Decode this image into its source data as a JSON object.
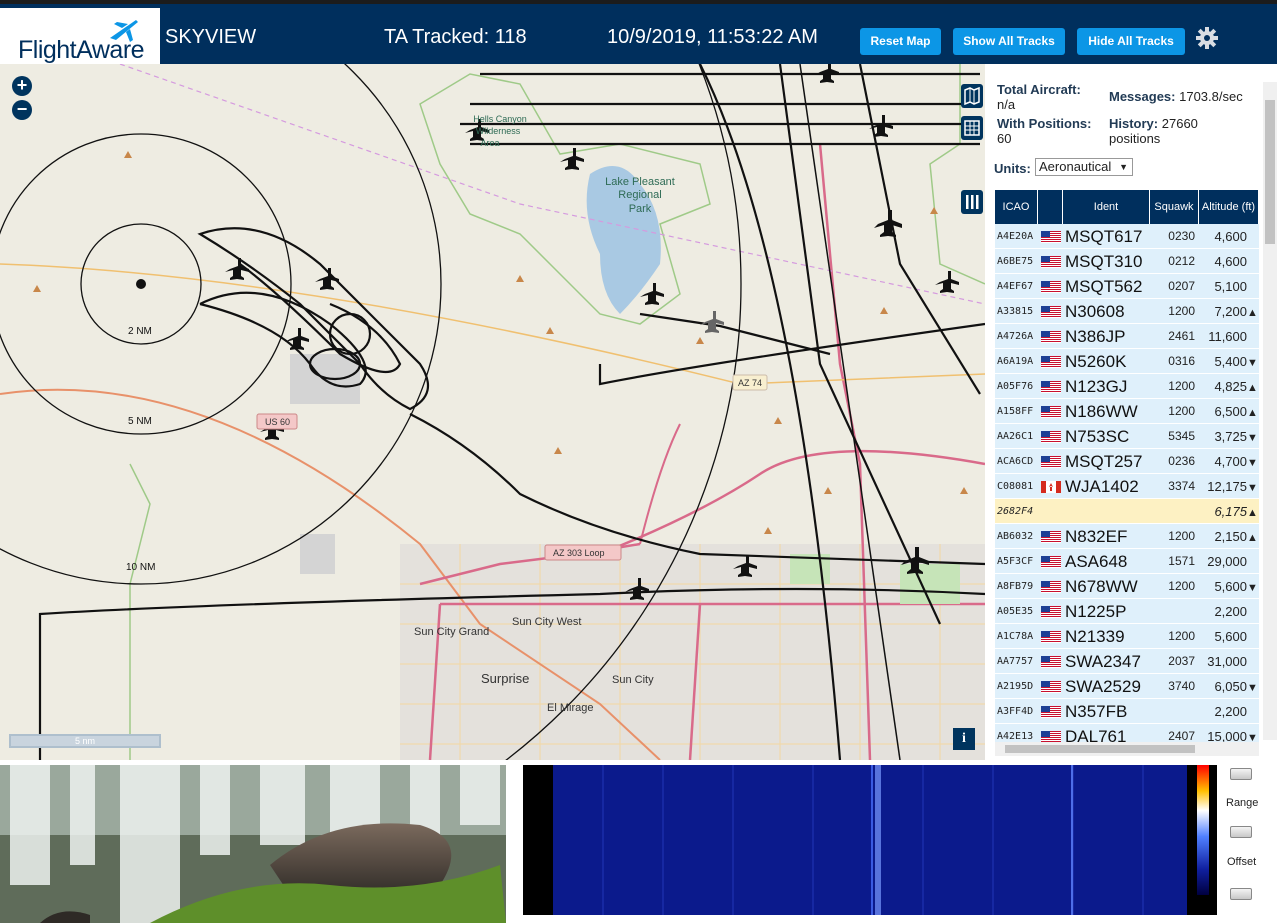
{
  "app": {
    "brand": "FlightAware",
    "title": "SKYVIEW",
    "ta_tracked_label": "TA Tracked: 118",
    "datetime": "10/9/2019, 11:53:22 AM",
    "buttons": {
      "reset_map": "Reset Map",
      "show_all_tracks": "Show All Tracks",
      "hide_all_tracks": "Hide All Tracks"
    }
  },
  "map": {
    "place_labels": [
      "Lake Pleasant Regional Park",
      "Sun City Grand",
      "Sun City West",
      "Surprise",
      "Sun City",
      "El Mirage",
      "Hells Canyon Wilderness Area"
    ],
    "road_labels": [
      "US 60",
      "AZ 74",
      "AZ 303 Loop"
    ],
    "range_rings": [
      "2 NM",
      "5 NM",
      "10 NM"
    ],
    "scale_label": "5 nm"
  },
  "sidebar": {
    "total_aircraft_label": "Total Aircraft:",
    "total_aircraft_value": "n/a",
    "with_positions_label": "With Positions:",
    "with_positions_value": "60",
    "messages_label": "Messages:",
    "messages_value": "1703.8/sec",
    "history_label": "History:",
    "history_value": "27660",
    "history_unit": "positions",
    "units_label": "Units:",
    "units_value": "Aeronautical",
    "columns": [
      "ICAO",
      "",
      "Ident",
      "Squawk",
      "Altitude (ft)"
    ],
    "rows": [
      {
        "icao": "A4E20A",
        "flag": "us",
        "ident": "MSQT617",
        "squawk": "0230",
        "alt": "4,600",
        "trend": ""
      },
      {
        "icao": "A6BE75",
        "flag": "us",
        "ident": "MSQT310",
        "squawk": "0212",
        "alt": "4,600",
        "trend": ""
      },
      {
        "icao": "A4EF67",
        "flag": "us",
        "ident": "MSQT562",
        "squawk": "0207",
        "alt": "5,100",
        "trend": ""
      },
      {
        "icao": "A33815",
        "flag": "us",
        "ident": "N30608",
        "squawk": "1200",
        "alt": "7,200",
        "trend": "▲"
      },
      {
        "icao": "A4726A",
        "flag": "us",
        "ident": "N386JP",
        "squawk": "2461",
        "alt": "11,600",
        "trend": ""
      },
      {
        "icao": "A6A19A",
        "flag": "us",
        "ident": "N5260K",
        "squawk": "0316",
        "alt": "5,400",
        "trend": "▼"
      },
      {
        "icao": "A05F76",
        "flag": "us",
        "ident": "N123GJ",
        "squawk": "1200",
        "alt": "4,825",
        "trend": "▲"
      },
      {
        "icao": "A158FF",
        "flag": "us",
        "ident": "N186WW",
        "squawk": "1200",
        "alt": "6,500",
        "trend": "▲"
      },
      {
        "icao": "AA26C1",
        "flag": "us",
        "ident": "N753SC",
        "squawk": "5345",
        "alt": "3,725",
        "trend": "▼"
      },
      {
        "icao": "ACA6CD",
        "flag": "us",
        "ident": "MSQT257",
        "squawk": "0236",
        "alt": "4,700",
        "trend": "▼"
      },
      {
        "icao": "C08081",
        "flag": "ca",
        "ident": "WJA1402",
        "squawk": "3374",
        "alt": "12,175",
        "trend": "▼"
      },
      {
        "icao": "2682F4",
        "flag": "",
        "ident": "",
        "squawk": "",
        "alt": "6,175",
        "trend": "▲",
        "selected": true
      },
      {
        "icao": "AB6032",
        "flag": "us",
        "ident": "N832EF",
        "squawk": "1200",
        "alt": "2,150",
        "trend": "▲"
      },
      {
        "icao": "A5F3CF",
        "flag": "us",
        "ident": "ASA648",
        "squawk": "1571",
        "alt": "29,000",
        "trend": ""
      },
      {
        "icao": "A8FB79",
        "flag": "us",
        "ident": "N678WW",
        "squawk": "1200",
        "alt": "5,600",
        "trend": "▼"
      },
      {
        "icao": "A05E35",
        "flag": "us",
        "ident": "N1225P",
        "squawk": "",
        "alt": "2,200",
        "trend": ""
      },
      {
        "icao": "A1C78A",
        "flag": "us",
        "ident": "N21339",
        "squawk": "1200",
        "alt": "5,600",
        "trend": ""
      },
      {
        "icao": "AA7757",
        "flag": "us",
        "ident": "SWA2347",
        "squawk": "2037",
        "alt": "31,000",
        "trend": ""
      },
      {
        "icao": "A2195D",
        "flag": "us",
        "ident": "SWA2529",
        "squawk": "3740",
        "alt": "6,050",
        "trend": "▼"
      },
      {
        "icao": "A3FF4D",
        "flag": "us",
        "ident": "N357FB",
        "squawk": "",
        "alt": "2,200",
        "trend": ""
      },
      {
        "icao": "A42E13",
        "flag": "us",
        "ident": "DAL761",
        "squawk": "2407",
        "alt": "15,000",
        "trend": "▼"
      }
    ]
  },
  "spectrum": {
    "range_label": "Range",
    "offset_label": "Offset"
  },
  "colors": {
    "header_bg": "#002f5d",
    "button_bg": "#0c96e6",
    "row_bg": "#dff0fb",
    "row_selected_bg": "#fdf1c3"
  }
}
